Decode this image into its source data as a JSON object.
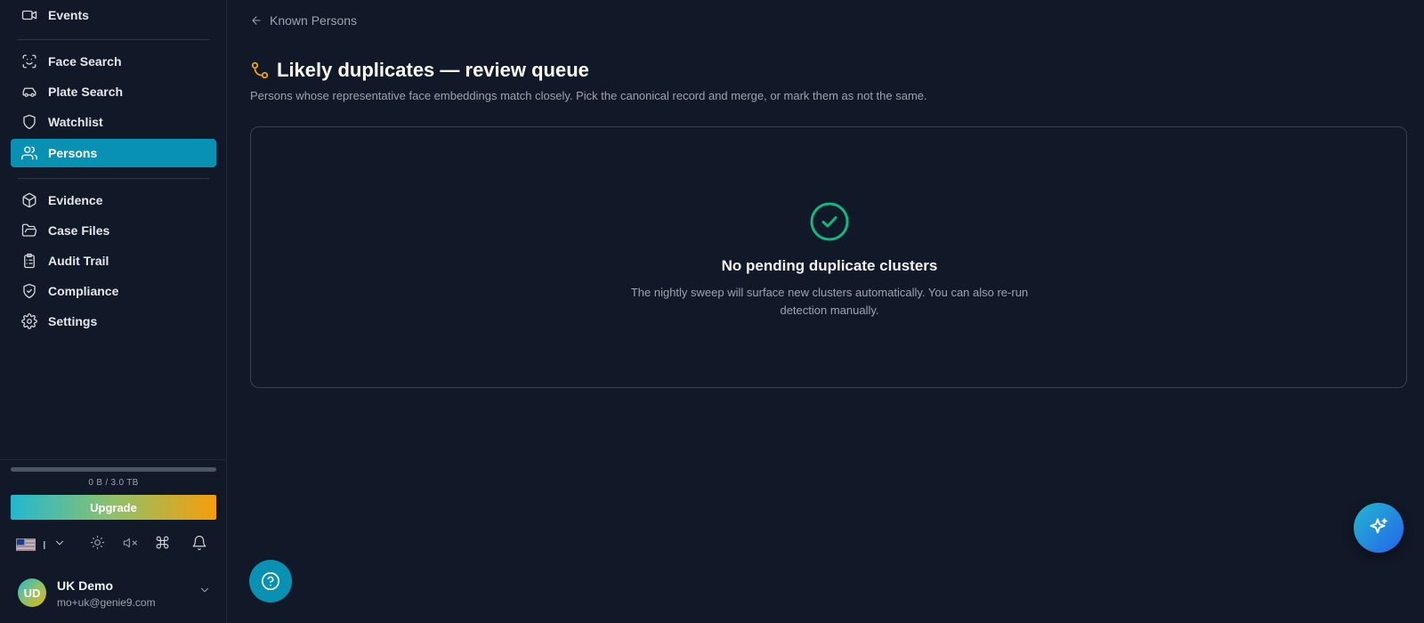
{
  "sidebar": {
    "items": [
      {
        "label": "Events",
        "icon": "video-camera-icon"
      },
      {
        "label": "Face Search",
        "icon": "face-scan-icon"
      },
      {
        "label": "Plate Search",
        "icon": "car-icon"
      },
      {
        "label": "Watchlist",
        "icon": "shield-icon"
      },
      {
        "label": "Persons",
        "icon": "users-icon",
        "active": true
      },
      {
        "label": "Evidence",
        "icon": "box-icon"
      },
      {
        "label": "Case Files",
        "icon": "folder-open-icon"
      },
      {
        "label": "Audit Trail",
        "icon": "clipboard-list-icon"
      },
      {
        "label": "Compliance",
        "icon": "shield-check-icon"
      },
      {
        "label": "Settings",
        "icon": "gear-icon"
      }
    ],
    "storage": {
      "text": "0 B / 3.0 TB",
      "used_fraction": 0
    },
    "upgrade_label": "Upgrade",
    "language_code": "I",
    "user": {
      "initials": "UD",
      "name": "UK Demo",
      "email": "mo+uk@genie9.com"
    }
  },
  "main": {
    "back_label": "Known Persons",
    "title": "Likely duplicates — review queue",
    "subtitle": "Persons whose representative face embeddings match closely. Pick the canonical record and merge, or mark them as not the same.",
    "empty_state": {
      "title": "No pending duplicate clusters",
      "description": "The nightly sweep will surface new clusters automatically. You can also re-run detection manually."
    }
  },
  "colors": {
    "background": "#111827",
    "active_nav": "#0891b2",
    "accent_orange": "#f59e0b",
    "success_green": "#10b981"
  }
}
